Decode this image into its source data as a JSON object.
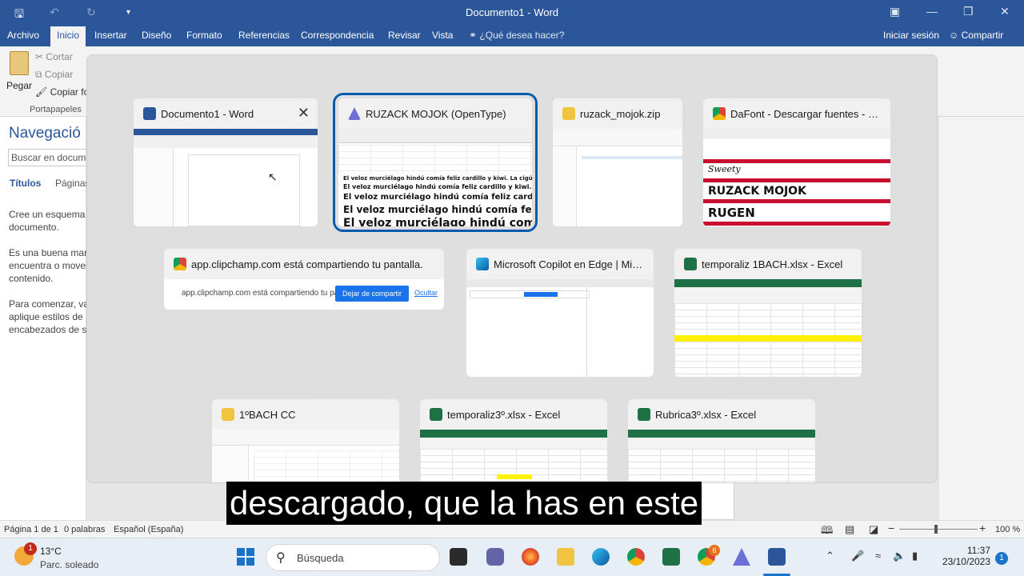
{
  "word": {
    "title": "Documento1 - Word",
    "tabs": [
      "Archivo",
      "Inicio",
      "Insertar",
      "Diseño",
      "Formato",
      "Referencias",
      "Correspondencia",
      "Revisar",
      "Vista"
    ],
    "active_tab": "Inicio",
    "tell_me": "¿Qué desea hacer?",
    "sign_in": "Iniciar sesión",
    "share": "Compartir",
    "clipboard": {
      "paste": "Pegar",
      "cut": "Cortar",
      "copy": "Copiar",
      "format_painter": "Copiar fo",
      "group": "Portapapeles"
    }
  },
  "nav_pane": {
    "title": "Navegació",
    "search_placeholder": "Buscar en docume",
    "tab_headings": "Títulos",
    "tab_pages": "Páginas",
    "para1": "Cree un esquema i documento.",
    "para2": "Es una buena man encuentra o mover contenido.",
    "para3": "Para comenzar, vay aplique estilos de encabezados de su"
  },
  "status_bar": {
    "page": "Página 1 de 1",
    "words": "0 palabras",
    "language": "Español (España)",
    "zoom": "100 %"
  },
  "switcher": {
    "windows": [
      {
        "label": "Documento1 - Word",
        "icon": "word-icon"
      },
      {
        "label": "RUZACK MOJOK (OpenType)",
        "icon": "font-viewer-icon"
      },
      {
        "label": "ruzack_mojok.zip",
        "icon": "folder-icon"
      },
      {
        "label": "DaFont - Descargar fuentes - Go...",
        "icon": "chrome-icon"
      },
      {
        "label": "app.clipchamp.com está compartiendo tu pantalla.",
        "icon": "chrome-icon"
      },
      {
        "label": "Microsoft Copilot en Edge | Micr...",
        "icon": "edge-icon"
      },
      {
        "label": "temporaliz 1BACH.xlsx - Excel",
        "icon": "excel-icon"
      },
      {
        "label": "1ºBACH CC",
        "icon": "folder-icon"
      },
      {
        "label": "temporaliz3º.xlsx - Excel",
        "icon": "excel-icon"
      },
      {
        "label": "Rubrica3º.xlsx - Excel",
        "icon": "excel-icon"
      }
    ],
    "selected_index": 1,
    "font_sample": "El veloz murciélago hindú comía feliz cardillo y kiwi. La cigüeña tocaba el saxofón",
    "font_sample_short": "El veloz murciélago hindú comía feliz ca",
    "dafont_names": [
      "Sweety",
      "RUZACK MOJOK",
      "RUGEN"
    ],
    "share_bar": {
      "text": "app.clipchamp.com está compartiendo tu pantalla.",
      "stop": "Dejar de compartir",
      "hide": "Ocultar"
    }
  },
  "caption": "descargado, que la has en este",
  "taskbar": {
    "weather_temp": "13°C",
    "weather_cond": "Parc. soleado",
    "weather_badge": "1",
    "search_label": "Búsqueda",
    "chrome_badge": "6",
    "time": "11:37",
    "date": "23/10/2023",
    "notifications": "1"
  },
  "colors": {
    "word_blue": "#2b579a",
    "selection_outline": "#0a5bb0",
    "excel_green": "#1e7145"
  }
}
